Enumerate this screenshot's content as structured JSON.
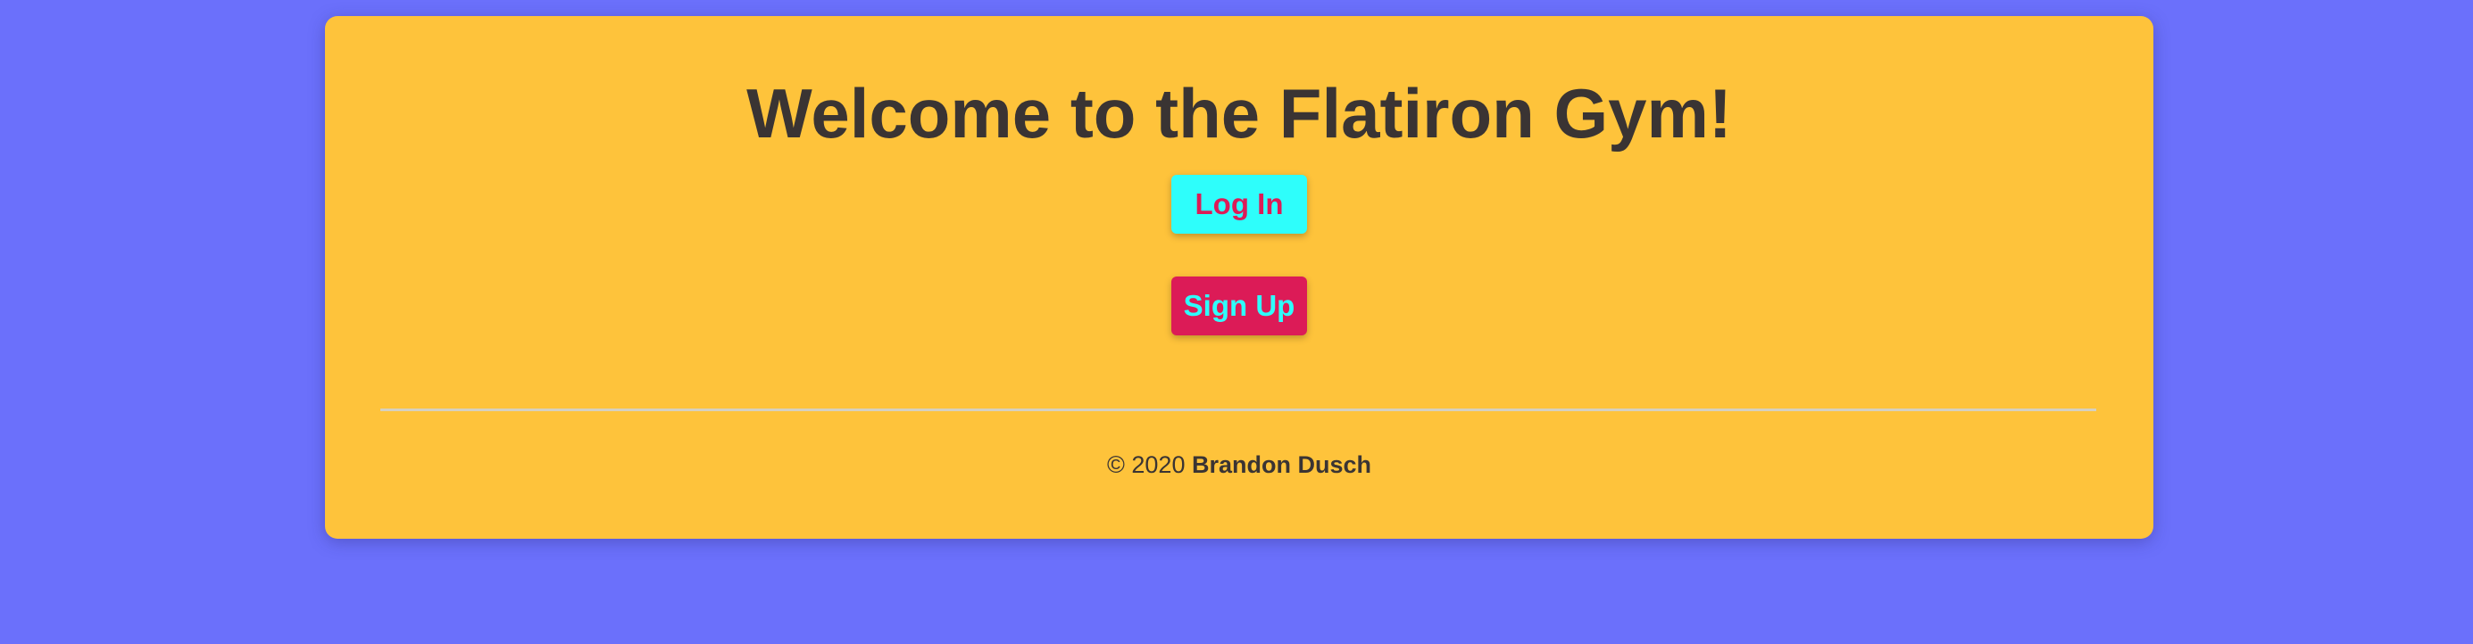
{
  "page": {
    "title": "Welcome to the Flatiron Gym!"
  },
  "buttons": {
    "login_label": "Log In",
    "signup_label": "Sign Up"
  },
  "footer": {
    "copyright": "© 2020",
    "author": "Brandon Dusch"
  },
  "colors": {
    "background": "#6b70fb",
    "card": "#fec33b",
    "text": "#3a3433",
    "accent_cyan": "#2efefb",
    "accent_pink": "#dc1b57"
  }
}
